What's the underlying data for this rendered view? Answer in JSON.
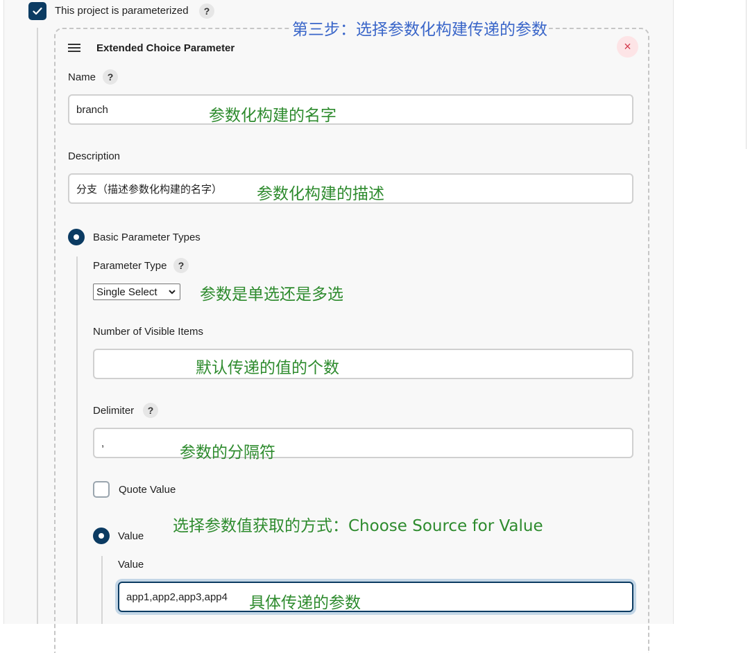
{
  "project": {
    "parameterized_label": "This project is parameterized",
    "help": "?"
  },
  "parameter": {
    "title": "Extended Choice Parameter",
    "close_symbol": "×",
    "name": {
      "label": "Name",
      "help": "?",
      "value": "branch"
    },
    "description": {
      "label": "Description",
      "value": "分支（描述参数化构建的名字）"
    },
    "basic_types_label": "Basic Parameter Types",
    "parameter_type": {
      "label": "Parameter Type",
      "help": "?",
      "selected": "Single Select"
    },
    "visible_items": {
      "label": "Number of Visible Items",
      "value": ""
    },
    "delimiter": {
      "label": "Delimiter",
      "help": "?",
      "value": ","
    },
    "quote_value": {
      "label": "Quote Value"
    },
    "value_radio": {
      "label": "Value"
    },
    "value_field": {
      "label": "Value",
      "value": "app1,app2,app3,app4"
    }
  },
  "annotations": {
    "step3": "第三步：选择参数化构建传递的参数",
    "name_note": "参数化构建的名字",
    "desc_note": "参数化构建的描述",
    "type_note": "参数是单选还是多选",
    "visible_note": "默认传递的值的个数",
    "delim_note": "参数的分隔符",
    "source_note": "选择参数值获取的方式：Choose  Source  for  Value",
    "value_note": "具体传递的参数"
  },
  "colors": {
    "accent": "#0b3b62",
    "annotation_green": "#2e8b2e",
    "annotation_blue": "#3a66c9",
    "close_red": "#d33b4d"
  },
  "icons": [
    "check-icon",
    "help-icon",
    "hamburger-menu-icon",
    "close-icon",
    "chevron-down-icon"
  ]
}
